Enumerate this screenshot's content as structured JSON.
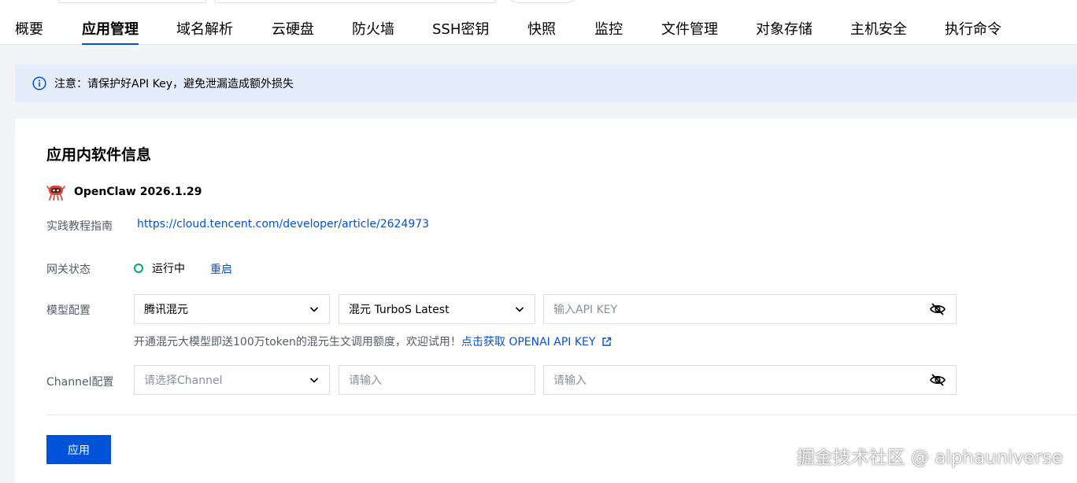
{
  "nav": {
    "tabs": [
      {
        "label": "概要",
        "active": false
      },
      {
        "label": "应用管理",
        "active": true
      },
      {
        "label": "域名解析",
        "active": false
      },
      {
        "label": "云硬盘",
        "active": false
      },
      {
        "label": "防火墙",
        "active": false
      },
      {
        "label": "SSH密钥",
        "active": false
      },
      {
        "label": "快照",
        "active": false
      },
      {
        "label": "监控",
        "active": false
      },
      {
        "label": "文件管理",
        "active": false
      },
      {
        "label": "对象存储",
        "active": false
      },
      {
        "label": "主机安全",
        "active": false
      },
      {
        "label": "执行命令",
        "active": false
      }
    ]
  },
  "notice": {
    "text": "注意：请保护好API Key，避免泄漏造成额外损失",
    "icon": "info-icon"
  },
  "card": {
    "title": "应用内软件信息",
    "app": {
      "name": "OpenClaw 2026.1.29",
      "icon": "openclaw-logo-icon"
    },
    "guide": {
      "label": "实践教程指南",
      "url": "https://cloud.tencent.com/developer/article/2624973"
    },
    "gateway": {
      "label": "网关状态",
      "status": "运行中",
      "restart": "重启",
      "status_color": "#00a870"
    },
    "model": {
      "label": "模型配置",
      "provider": "腾讯混元",
      "model": "混元 TurboS Latest",
      "api_key_placeholder": "输入API KEY",
      "hint": "开通混元大模型即送100万token的混元生文调用额度，欢迎试用！",
      "hint_link": "点击获取 OPENAI API KEY"
    },
    "channel": {
      "label": "Channel配置",
      "select_placeholder": "请选择Channel",
      "input1_placeholder": "请输入",
      "input2_placeholder": "请输入"
    },
    "apply": "应用"
  },
  "watermark": "掘金技术社区 @ alphauniverse",
  "colors": {
    "primary": "#0052d9",
    "notice_bg": "#e5edfb",
    "success": "#00a870",
    "page_bg": "#f3f4f7"
  }
}
